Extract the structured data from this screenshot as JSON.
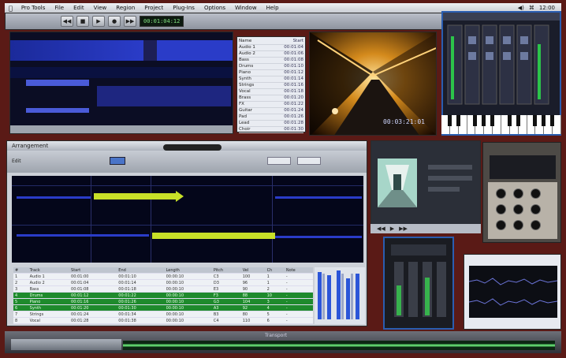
{
  "menubar": {
    "apple": "",
    "items": [
      "Pro Tools",
      "File",
      "Edit",
      "View",
      "Region",
      "Project",
      "Plug-Ins",
      "Options",
      "Window",
      "Help"
    ],
    "right": [
      "◀)",
      "⌘",
      "12:00"
    ]
  },
  "toolbar": {
    "buttons": [
      "◀◀",
      "■",
      "▶",
      "●",
      "▶▶"
    ],
    "counter": "00:01:04:12"
  },
  "event_list": {
    "rows": [
      [
        "Name",
        "Start"
      ],
      [
        "Audio 1",
        "00:01:04"
      ],
      [
        "Audio 2",
        "00:01:06"
      ],
      [
        "Bass",
        "00:01:08"
      ],
      [
        "Drums",
        "00:01:10"
      ],
      [
        "Piano",
        "00:01:12"
      ],
      [
        "Synth",
        "00:01:14"
      ],
      [
        "Strings",
        "00:01:16"
      ],
      [
        "Vocal",
        "00:01:18"
      ],
      [
        "Brass",
        "00:01:20"
      ],
      [
        "FX",
        "00:01:22"
      ],
      [
        "Guitar",
        "00:01:24"
      ],
      [
        "Pad",
        "00:01:26"
      ],
      [
        "Lead",
        "00:01:28"
      ],
      [
        "Choir",
        "00:01:30"
      ]
    ]
  },
  "video": {
    "timecode": "00:03:21:01"
  },
  "main_window": {
    "title": "Arrangement",
    "mode_label": "Edit"
  },
  "event_table": {
    "header": [
      "#",
      "Track",
      "Start",
      "End",
      "Length",
      "Pitch",
      "Vel",
      "Ch",
      "Note"
    ],
    "rows": [
      [
        "1",
        "Audio 1",
        "00:01:00",
        "00:01:10",
        "00:00:10",
        "C3",
        "100",
        "1",
        "-"
      ],
      [
        "2",
        "Audio 2",
        "00:01:04",
        "00:01:14",
        "00:00:10",
        "D3",
        "96",
        "1",
        "-"
      ],
      [
        "3",
        "Bass",
        "00:01:08",
        "00:01:18",
        "00:00:10",
        "E3",
        "90",
        "2",
        "-"
      ],
      [
        "4",
        "Drums",
        "00:01:12",
        "00:01:22",
        "00:00:10",
        "F3",
        "88",
        "10",
        "-"
      ],
      [
        "5",
        "Piano",
        "00:01:16",
        "00:01:26",
        "00:00:10",
        "G3",
        "104",
        "3",
        "-"
      ],
      [
        "6",
        "Synth",
        "00:01:20",
        "00:01:30",
        "00:00:10",
        "A3",
        "92",
        "4",
        "-"
      ],
      [
        "7",
        "Strings",
        "00:01:24",
        "00:01:34",
        "00:00:10",
        "B3",
        "80",
        "5",
        "-"
      ],
      [
        "8",
        "Vocal",
        "00:01:28",
        "00:01:38",
        "00:00:10",
        "C4",
        "110",
        "6",
        "-"
      ]
    ],
    "highlight_rows": [
      3,
      4,
      5
    ]
  },
  "video_small": {
    "controls": [
      "◀◀",
      "▶",
      "▶▶"
    ]
  },
  "bottom": {
    "title": "Transport"
  },
  "colors": {
    "desktop": "#5a1a16",
    "arrange_bg": "#04061a",
    "region_blue": "#2a3cc8",
    "region_yellow": "#c8e028",
    "highlight_green": "#1e8a2c",
    "accent": "#2a5db0"
  }
}
